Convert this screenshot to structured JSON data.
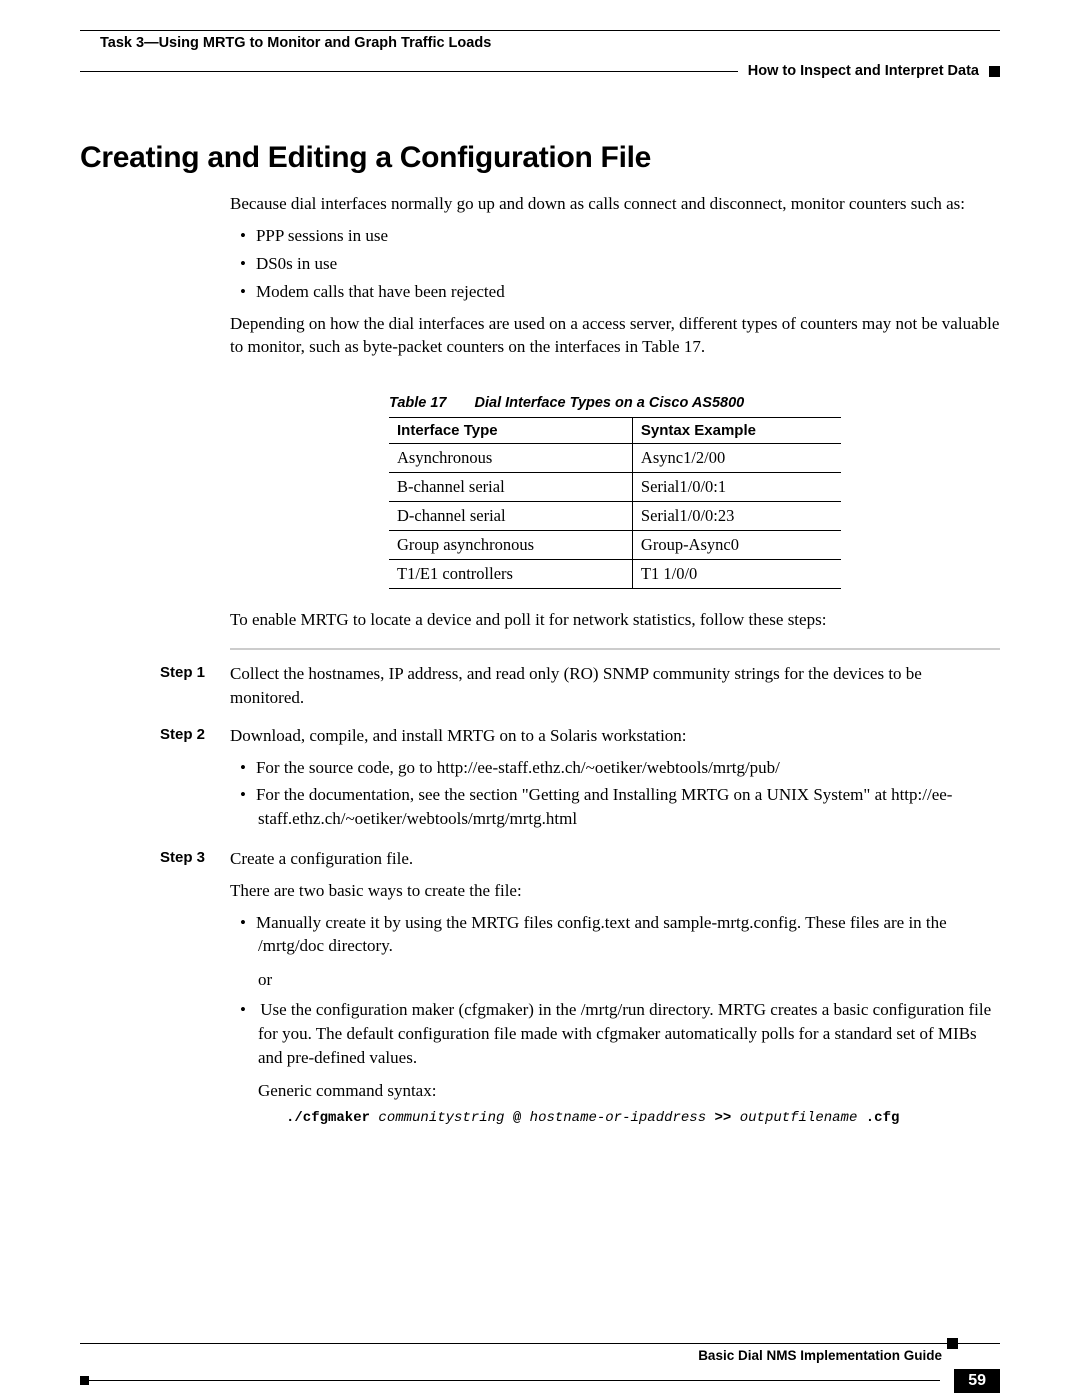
{
  "header": {
    "task": "Task 3—Using MRTG to Monitor and Graph Traffic Loads",
    "subsection": "How to Inspect and Interpret Data"
  },
  "title": "Creating and Editing a Configuration File",
  "intro": "Because dial interfaces normally go up and down as calls connect and disconnect, monitor counters such as:",
  "intro_bullets": [
    "PPP sessions in use",
    "DS0s in use",
    "Modem calls that have been rejected"
  ],
  "intro2": "Depending on how the dial interfaces are used on a access server, different types of counters may not be valuable to monitor, such as byte-packet counters on the interfaces in Table 17.",
  "table": {
    "caption_num": "Table 17",
    "caption_title": "Dial Interface Types on a Cisco AS5800",
    "headers": [
      "Interface Type",
      "Syntax Example"
    ],
    "rows": [
      [
        "Asynchronous",
        "Async1/2/00"
      ],
      [
        "B-channel serial",
        "Serial1/0/0:1"
      ],
      [
        "D-channel serial",
        "Serial1/0/0:23"
      ],
      [
        "Group asynchronous",
        "Group-Async0"
      ],
      [
        "T1/E1 controllers",
        "T1 1/0/0"
      ]
    ]
  },
  "after_table": "To enable MRTG to locate a device and poll it for network statistics, follow these steps:",
  "steps": [
    {
      "label": "Step 1",
      "text": "Collect the hostnames, IP address, and read only (RO) SNMP community strings for the devices to be monitored."
    },
    {
      "label": "Step 2",
      "text": "Download, compile, and install MRTG on to a Solaris workstation:",
      "bullets": [
        "For the source code, go to http://ee-staff.ethz.ch/~oetiker/webtools/mrtg/pub/",
        "For the documentation, see the section \"Getting and Installing MRTG on a UNIX System\" at http://ee-staff.ethz.ch/~oetiker/webtools/mrtg/mrtg.html"
      ]
    },
    {
      "label": "Step 3",
      "text": "Create a configuration file.",
      "sub1": "There are two basic ways to create the file:",
      "bullet1": "Manually create it by using the MRTG files config.text and sample-mrtg.config. These files are in the /mrtg/doc directory.",
      "or": "or",
      "bullet2": "Use the configuration maker (cfgmaker) in the /mrtg/run directory. MRTG creates a basic configuration file for you. The default configuration file made with cfgmaker automatically polls for a standard set of MIBs and pre-defined values.",
      "generic": "Generic command syntax:",
      "code_bold1": "./cfgmaker",
      "code_ital1": "communitystring",
      "code_bold2": "@",
      "code_ital2": "hostname-or-ipaddress",
      "code_bold3": ">>",
      "code_ital3": "outputfilename",
      "code_bold4": ".cfg"
    }
  ],
  "footer": {
    "guide": "Basic Dial NMS Implementation Guide",
    "page": "59"
  }
}
